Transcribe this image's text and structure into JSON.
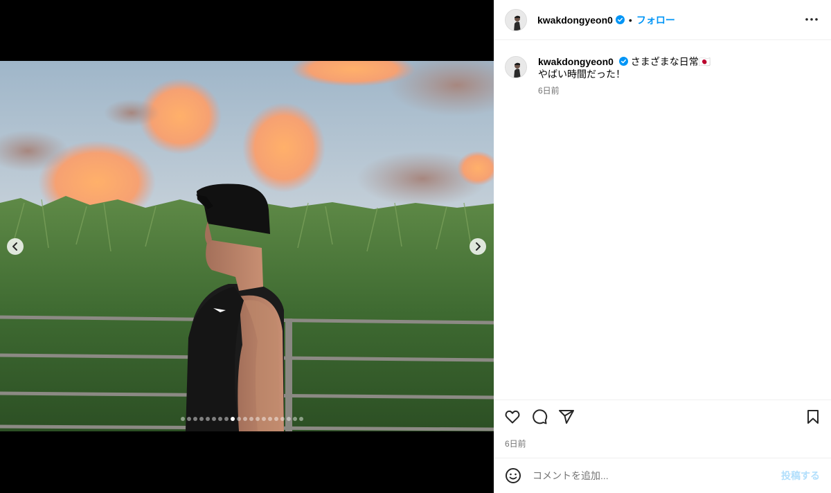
{
  "post": {
    "username": "kwakdongyeon0",
    "follow_label": "フォロー",
    "separator": "•",
    "caption_line1": "さまざまな日常🇯🇵",
    "caption_line2": "やばい時間だった！",
    "caption_time": "6日前",
    "post_time": "6日前"
  },
  "carousel": {
    "total_slides": 20,
    "active_index": 8
  },
  "comment": {
    "placeholder": "コメントを追加...",
    "post_label": "投稿する"
  },
  "colors": {
    "accent": "#0095f6",
    "verified": "#0095f6",
    "post_disabled": "#b2dffc"
  },
  "icons": {
    "like": "heart-icon",
    "comment": "comment-icon",
    "share": "send-icon",
    "save": "bookmark-icon",
    "emoji": "smiley-icon",
    "more": "more-options-icon"
  }
}
